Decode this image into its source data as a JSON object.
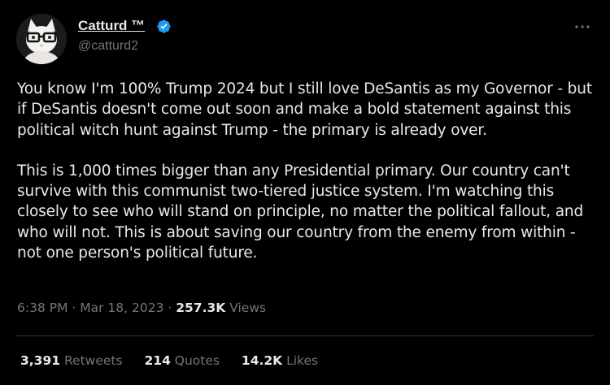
{
  "author": {
    "name": "Catturd ™",
    "handle": "@catturd2",
    "verified_color": "#1d9bf0"
  },
  "more_icon": "ellipsis-icon",
  "tweet": {
    "paragraphs": [
      "You know I'm 100% Trump 2024 but I still love DeSantis as my Governor - but if DeSantis doesn't come out soon and make a bold statement against this political witch hunt against Trump - the primary is already over.",
      "This is 1,000 times bigger than any Presidential primary. Our country can't survive with this communist two-tiered justice system.  I'm watching this closely to see who will stand on principle, no matter the political fallout, and who will not.  This is about saving our country from the enemy from within - not one person's political future."
    ]
  },
  "meta": {
    "time": "6:38 PM",
    "sep1": " · ",
    "date": "Mar 18, 2023",
    "sep2": " · ",
    "views_count": "257.3K",
    "views_label": " Views"
  },
  "stats": {
    "retweets": {
      "count": "3,391",
      "label": " Retweets"
    },
    "quotes": {
      "count": "214",
      "label": " Quotes"
    },
    "likes": {
      "count": "14.2K",
      "label": " Likes"
    }
  },
  "colors": {
    "background": "#000000",
    "text": "#e7e9ea",
    "muted": "#71767b",
    "divider": "#2f3336"
  }
}
